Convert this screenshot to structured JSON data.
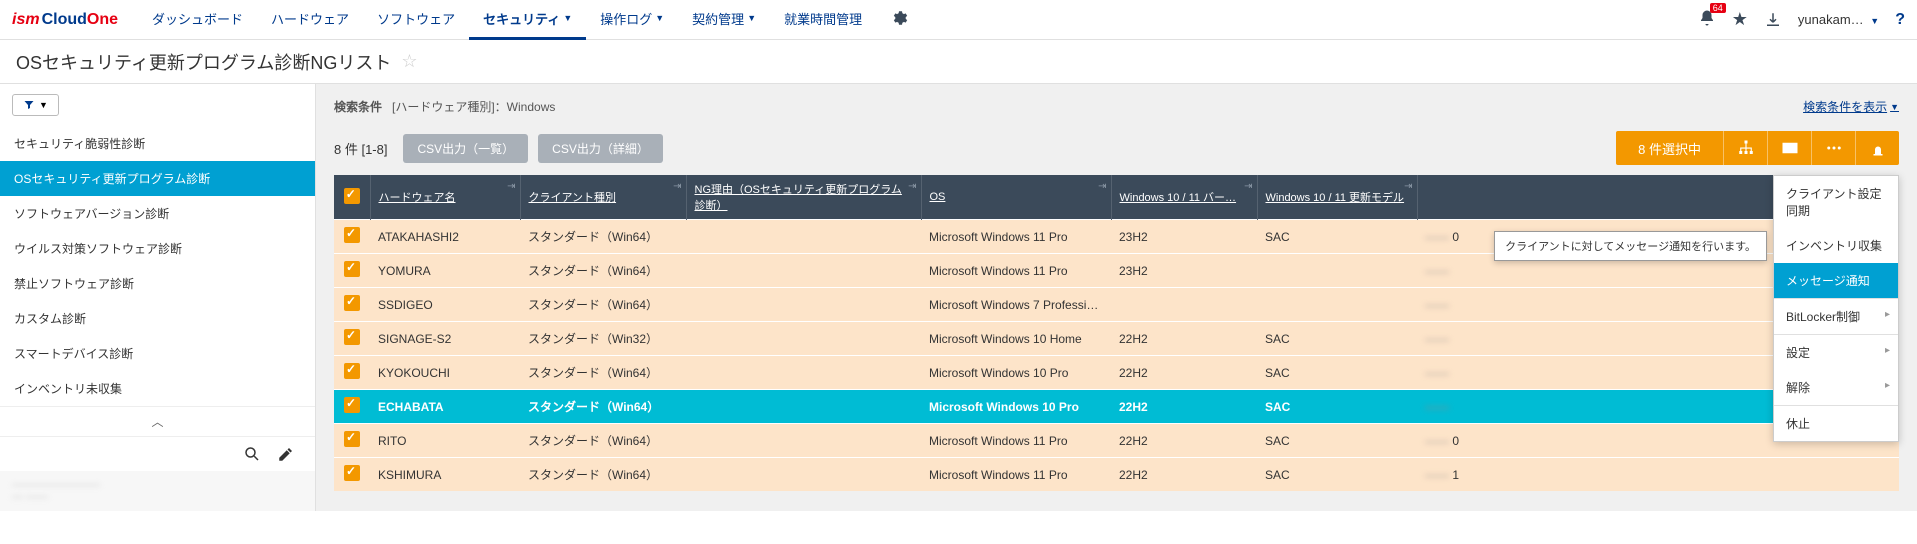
{
  "brand": {
    "ism": "ism",
    "cloud": "Cloud",
    "one": "One"
  },
  "topnav": {
    "items": [
      {
        "label": "ダッシュボード",
        "dropdown": false
      },
      {
        "label": "ハードウェア",
        "dropdown": false
      },
      {
        "label": "ソフトウェア",
        "dropdown": false
      },
      {
        "label": "セキュリティ",
        "dropdown": true,
        "active": true
      },
      {
        "label": "操作ログ",
        "dropdown": true
      },
      {
        "label": "契約管理",
        "dropdown": true
      },
      {
        "label": "就業時間管理",
        "dropdown": false
      }
    ],
    "badge": "64",
    "user": "yunakam…"
  },
  "page_title": "OSセキュリティ更新プログラム診断NGリスト",
  "sidebar": {
    "items": [
      {
        "label": "セキュリティ脆弱性診断"
      },
      {
        "label": "OSセキュリティ更新プログラム診断",
        "active": true
      },
      {
        "label": "ソフトウェアバージョン診断"
      },
      {
        "label": "ウイルス対策ソフトウェア診断"
      },
      {
        "label": "禁止ソフトウェア診断"
      },
      {
        "label": "カスタム診断"
      },
      {
        "label": "スマートデバイス診断"
      },
      {
        "label": "インベントリ未収集"
      }
    ],
    "info_lines": [
      "————————",
      "— ——"
    ]
  },
  "condition": {
    "label": "検索条件",
    "text": "[ハードウェア種別]：Windows",
    "show_link": "検索条件を表示"
  },
  "toolbar": {
    "count": "8 件  [1-8]",
    "csv1": "CSV出力（一覧）",
    "csv2": "CSV出力（詳細）",
    "selected": "8 件選択中"
  },
  "columns": [
    "ハードウェア名",
    "クライアント種別",
    "NG理由（OSセキュリティ更新プログラム診断）",
    "OS",
    "Windows 10 / 11 バー…",
    "Windows 10 / 11 更新モデル",
    ""
  ],
  "rows": [
    {
      "hw": "ATAKAHASHI2",
      "ct": "スタンダード（Win64）",
      "ng": "",
      "os": "Microsoft Windows 11 Pro",
      "ver": "23H2",
      "model": "SAC",
      "last": "0"
    },
    {
      "hw": "YOMURA",
      "ct": "スタンダード（Win64）",
      "ng": "",
      "os": "Microsoft Windows 11 Pro",
      "ver": "23H2",
      "model": "",
      "last": ""
    },
    {
      "hw": "SSDIGEO",
      "ct": "スタンダード（Win64）",
      "ng": "",
      "os": "Microsoft Windows 7 Professional",
      "ver": "",
      "model": "",
      "last": ""
    },
    {
      "hw": "SIGNAGE-S2",
      "ct": "スタンダード（Win32）",
      "ng": "",
      "os": "Microsoft Windows 10 Home",
      "ver": "22H2",
      "model": "SAC",
      "last": ""
    },
    {
      "hw": "KYOKOUCHI",
      "ct": "スタンダード（Win64）",
      "ng": "",
      "os": "Microsoft Windows 10 Pro",
      "ver": "22H2",
      "model": "SAC",
      "last": ""
    },
    {
      "hw": "ECHABATA",
      "ct": "スタンダード（Win64）",
      "ng": "",
      "os": "Microsoft Windows 10 Pro",
      "ver": "22H2",
      "model": "SAC",
      "last": "",
      "hl": true
    },
    {
      "hw": "RITO",
      "ct": "スタンダード（Win64）",
      "ng": "",
      "os": "Microsoft Windows 11 Pro",
      "ver": "22H2",
      "model": "SAC",
      "last": "0"
    },
    {
      "hw": "KSHIMURA",
      "ct": "スタンダード（Win64）",
      "ng": "",
      "os": "Microsoft Windows 11 Pro",
      "ver": "22H2",
      "model": "SAC",
      "last": "1"
    }
  ],
  "menu": {
    "items": [
      {
        "label": "クライアント設定同期"
      },
      {
        "label": "インベントリ収集"
      },
      {
        "label": "メッセージ通知",
        "on": true
      },
      {
        "label": "BitLocker制御",
        "sep": true,
        "arrow": true
      },
      {
        "label": "設定",
        "sep": true,
        "arrow": true
      },
      {
        "label": "解除",
        "arrow": true
      },
      {
        "label": "休止",
        "sep": true
      }
    ]
  },
  "tooltip": "クライアントに対してメッセージ通知を行います。"
}
